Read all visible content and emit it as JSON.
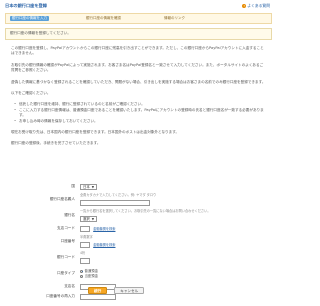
{
  "header": {
    "title": "日本の銀行口座を登録",
    "help_label": "よくある質問",
    "help_icon": "help-icon"
  },
  "steps": [
    {
      "label": "銀行口座の情報を入力",
      "active": true
    },
    {
      "label": "銀行口座の情報を確認",
      "active": false
    },
    {
      "label": "情報のリンク",
      "active": false
    }
  ],
  "notice": {
    "text": "銀行口座の情報を登録してください。"
  },
  "intro": {
    "paragraph_1": "この銀行口座を登録し、PayPalアカウントからこの銀行口座に残高を引き出すことができます。ただし、この銀行口座からPayPalアカウントに入金することはできません。",
    "paragraph_2": "お取引先の銀行情報の確認がPayPalによって実施されます。お客さま名はPayPal登録名と一致させて入力してください。また、ポータルサイトのよくあるご質問をご参照ください。",
    "paragraph_3": "虚偽した情報に基づかなく登録されることを確認していただき、問題がない場合、引き出しを実施する場合はお客さまの名前でのみ銀行口座を登録できます。",
    "paragraph_4": "以下をご確認ください。"
  },
  "bullets": [
    "信託した銀行口座を維持、銀行に登録されているのと名前がご確認ください。",
    "ここに入力する銀行口座情報は、普通預金口座であることを確認いたします。PayPalにアカウントの登録時の氏名と銀行口座名が一致する必要があります。",
    "お申し込み時の情報を保存しておいてください。"
  ],
  "outro": {
    "paragraph_1": "現在お受け取り先は、日本国内の銀行口座を登録できます。日本国外のポストは出金対象外となります。",
    "paragraph_2": "銀行口座の登録後、手続きを完了させていただきます。"
  },
  "form": {
    "country_label": "国",
    "country_value": "日本",
    "account_holder_label": "銀行口座名義人",
    "account_holder_hint": "全角カタカナで入力してください。例: ヤマダ タロウ",
    "bank_label": "銀行名",
    "bank_hint": "一覧から銀行名を選択してください。お取引先の一覧にない場合はお問い合わせください。",
    "bank_value": "選択",
    "branch_code_label": "支店コード",
    "branch_code_link": "金融機関を検索",
    "account_code_label": "口座番号",
    "account_code_hint": "半角数字",
    "account_code_link": "金融機関を検索",
    "account_number_label": "銀行コード",
    "account_number_hint": "4桁",
    "account_type_label": "口座タイプ",
    "account_type_options": [
      "普通預金",
      "当座預金"
    ],
    "account_type_selected": 0,
    "branch_name_label": "支店名",
    "confirm_label": "口座番号の再入力"
  },
  "actions": {
    "continue_label": "続行",
    "cancel_label": "キャンセル"
  },
  "colors": {
    "accent": "#2a64a8",
    "primary_button": "#f6a623",
    "notice_bg": "#fffbea"
  }
}
